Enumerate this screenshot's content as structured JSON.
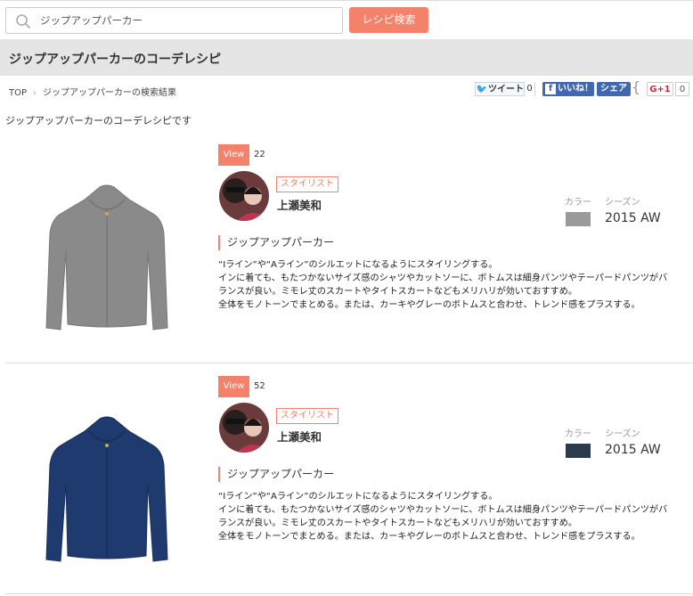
{
  "search": {
    "value": "ジップアップパーカー",
    "button_label": "レシピ検索"
  },
  "page_title": "ジップアップパーカーのコーデレシピ",
  "breadcrumb": {
    "home": "TOP",
    "current": "ジップアップパーカーの検索結果"
  },
  "social": {
    "tweet_label": "ツイート",
    "tweet_count": "0",
    "fb_like_label": "いいね！",
    "fb_share_label": "シェア",
    "gplus_label": "G+1",
    "gplus_count": "0"
  },
  "intro_text": "ジップアップパーカーのコーデレシピです",
  "recipes": [
    {
      "view_label": "View",
      "view_count": "22",
      "stylist_badge": "スタイリスト",
      "stylist_name": "上瀬美和",
      "color_label": "カラー",
      "season_label": "シーズン",
      "color_hex": "#9a9a9a",
      "season_value": "2015 AW",
      "item_title": "ジップアップパーカー",
      "product_color": "#8a8a8a",
      "description": [
        "“Iライン”や“Aライン”のシルエットになるようにスタイリングする。",
        "インに着ても、もたつかないサイズ感のシャツやカットソーに、ボトムスは細身パンツやテーパードパンツがバ",
        "ランスが良い。ミモレ丈のスカートやタイトスカートなどもメリハリが効いておすすめ。",
        "全体をモノトーンでまとめる。または、カーキやグレーのボトムスと合わせ、トレンド感をプラスする。"
      ]
    },
    {
      "view_label": "View",
      "view_count": "52",
      "stylist_badge": "スタイリスト",
      "stylist_name": "上瀬美和",
      "color_label": "カラー",
      "season_label": "シーズン",
      "color_hex": "#2c3a4e",
      "season_value": "2015 AW",
      "item_title": "ジップアップパーカー",
      "product_color": "#1f3a6e",
      "description": [
        "“Iライン”や“Aライン”のシルエットになるようにスタイリングする。",
        "インに着ても、もたつかないサイズ感のシャツやカットソーに、ボトムスは細身パンツやテーパードパンツがバ",
        "ランスが良い。ミモレ丈のスカートやタイトスカートなどもメリハリが効いておすすめ。",
        "全体をモノトーンでまとめる。または、カーキやグレーのボトムスと合わせ、トレンド感をプラスする。"
      ]
    }
  ]
}
